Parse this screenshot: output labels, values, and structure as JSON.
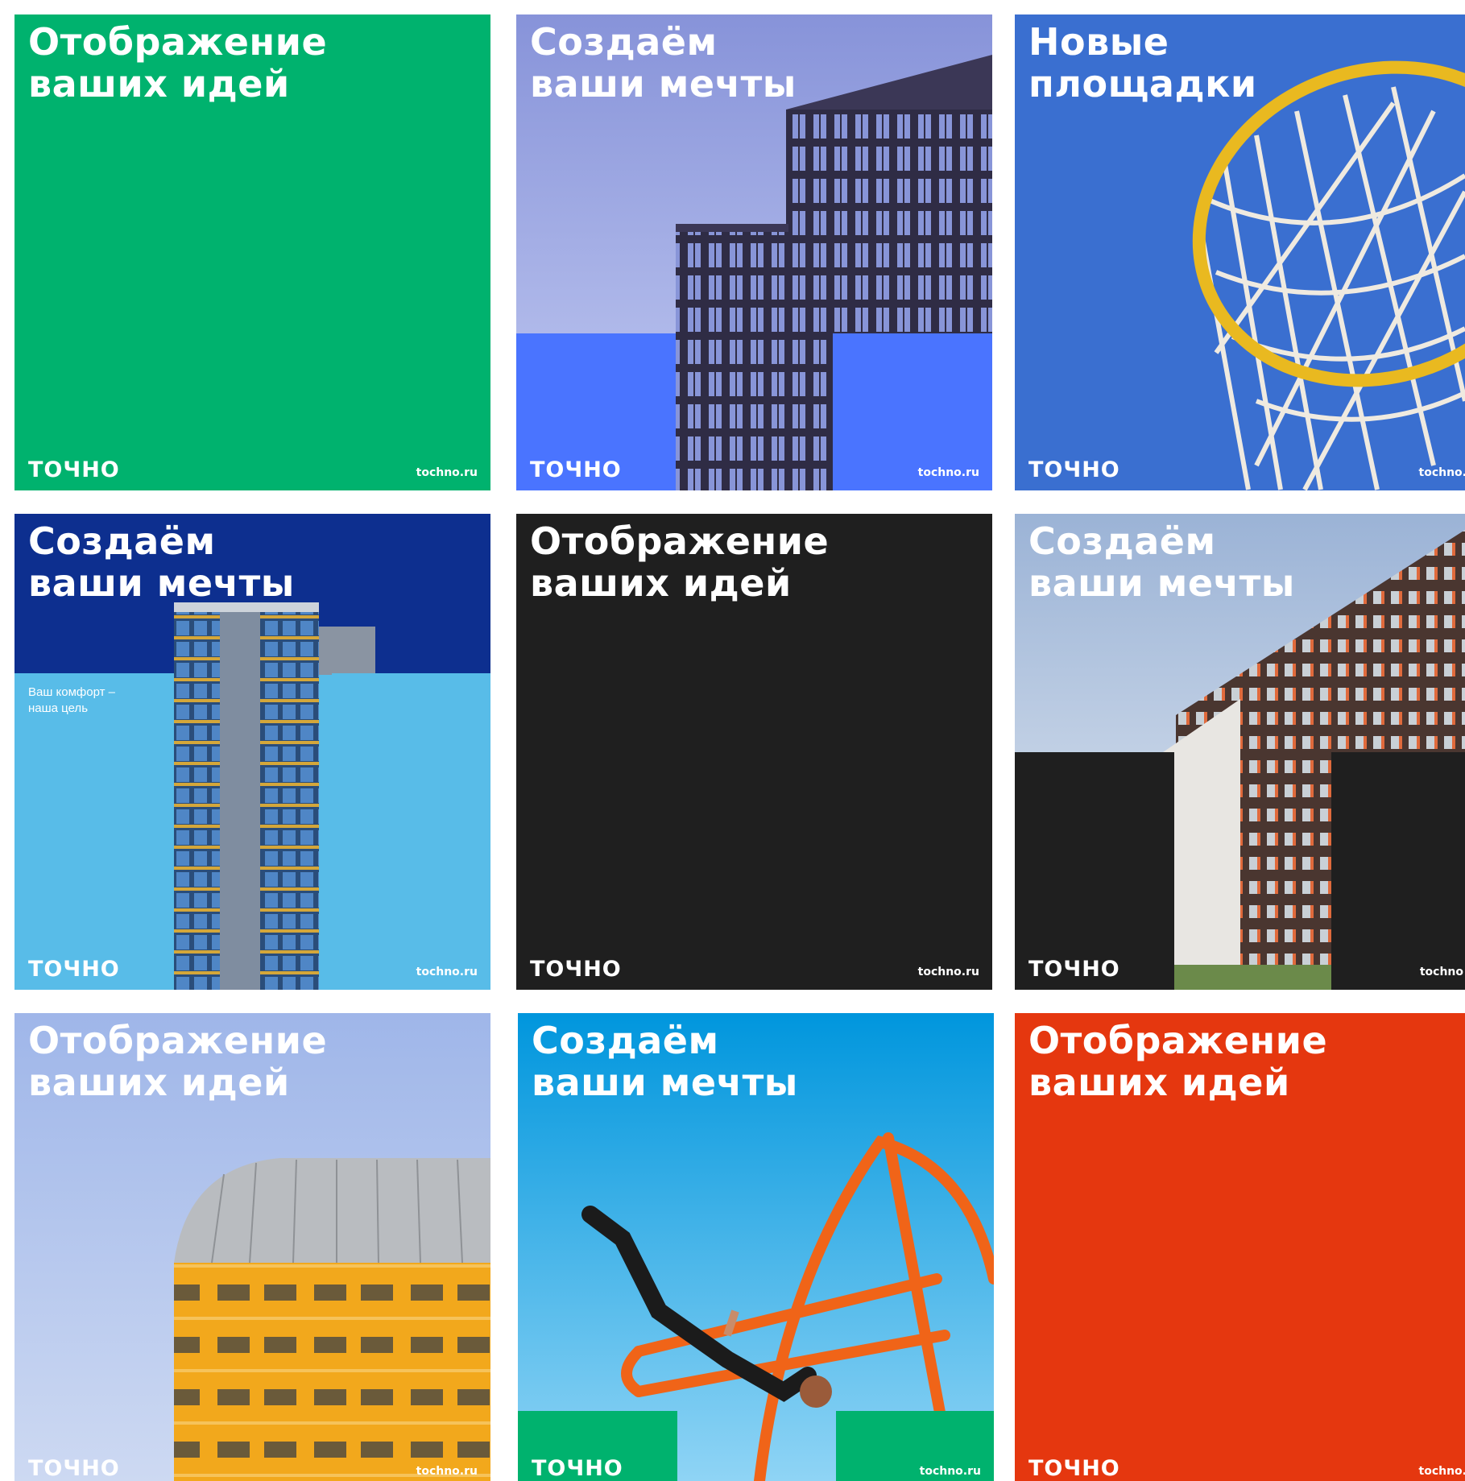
{
  "brand": {
    "logo": "ТОЧНО",
    "url": "tochno.ru"
  },
  "colors": {
    "green": "#00b26e",
    "blue_accent": "#4a74ff",
    "sky_blue": "#3a6fd0",
    "light_blue": "#58bce8",
    "dark": "#1f1f1f",
    "red": "#e5370f",
    "white": "#ffffff"
  },
  "cards": [
    {
      "title": [
        "Отображение",
        "ваших идей"
      ],
      "background": "green",
      "logo": "ТОЧНО",
      "url": "tochno.ru"
    },
    {
      "title": [
        "Создаём",
        "ваши мечты"
      ],
      "background": "photo-building-blue-blocks",
      "logo": "ТОЧНО",
      "url": "tochno.ru"
    },
    {
      "title": [
        "Новые",
        "площадки"
      ],
      "background": "photo-basketball-hoop",
      "logo": "ТОЧНО",
      "url": "tochno."
    },
    {
      "title": [
        "Создаём",
        "ваши мечты"
      ],
      "subtitle": [
        "Ваш комфорт –",
        "наша цель"
      ],
      "background": "photo-tower-light-blue",
      "logo": "ТОЧНО",
      "url": "tochno.ru"
    },
    {
      "title": [
        "Отображение",
        "ваших идей"
      ],
      "background": "dark",
      "logo": "ТОЧНО",
      "url": "tochno.ru"
    },
    {
      "title": [
        "Создаём",
        "ваши мечты"
      ],
      "background": "photo-brick-building-dark-blocks",
      "logo": "ТОЧНО",
      "url": "tochno"
    },
    {
      "title": [
        "Отображение",
        "ваших идей"
      ],
      "background": "photo-orange-dome-building",
      "logo": "ТОЧНО",
      "url": "tochno.ru"
    },
    {
      "title": [
        "Создаём",
        "ваши мечты"
      ],
      "background": "photo-playground-swing-green-blocks",
      "logo": "ТОЧНО",
      "url": "tochno.ru"
    },
    {
      "title": [
        "Отображение",
        "ваших идей"
      ],
      "background": "red",
      "logo": "ТОЧНО",
      "url": "tochno."
    }
  ]
}
